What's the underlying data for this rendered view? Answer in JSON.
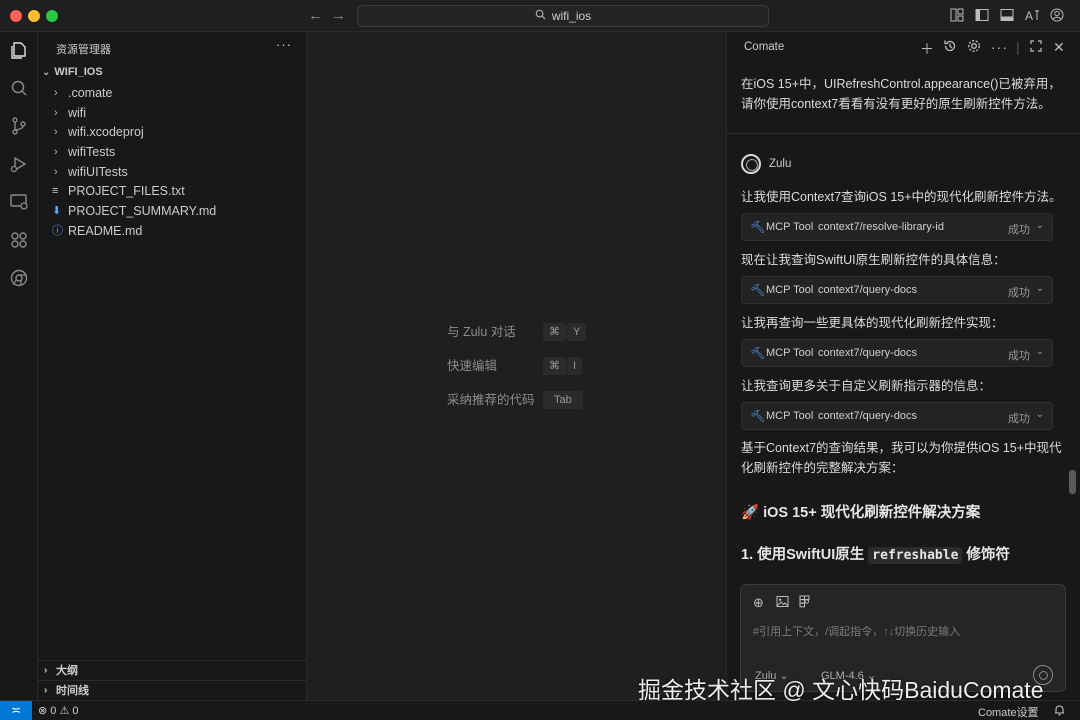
{
  "titlebar": {
    "search_text": "wifi_ios"
  },
  "sidebar": {
    "title": "资源管理器",
    "more": "···",
    "folder": "WIFI_IOS",
    "items": [
      {
        "label": ".comate",
        "kind": "folder"
      },
      {
        "label": "wifi",
        "kind": "folder"
      },
      {
        "label": "wifi.xcodeproj",
        "kind": "folder"
      },
      {
        "label": "wifiTests",
        "kind": "folder"
      },
      {
        "label": "wifiUITests",
        "kind": "folder"
      },
      {
        "label": "PROJECT_FILES.txt",
        "kind": "file-text"
      },
      {
        "label": "PROJECT_SUMMARY.md",
        "kind": "file-download"
      },
      {
        "label": "README.md",
        "kind": "file-info"
      }
    ],
    "outline": "大纲",
    "timeline": "时间线"
  },
  "editor": {
    "hints": [
      {
        "label": "与 Zulu 对话",
        "keys": [
          "⌘",
          "Y"
        ]
      },
      {
        "label": "快速编辑",
        "keys": [
          "⌘",
          "I"
        ]
      },
      {
        "label": "采纳推荐的代码",
        "keys": [
          "Tab"
        ]
      }
    ]
  },
  "panel": {
    "title": "Comate",
    "user_message": "在iOS 15+中，UIRefreshControl.appearance()已被弃用，请你使用context7看看有没有更好的原生刷新控件方法。",
    "bot_name": "Zulu",
    "lines": [
      "让我使用Context7查询iOS 15+中的现代化刷新控件方法。",
      "现在让我查询SwiftUI原生刷新控件的具体信息：",
      "让我再查询一些更具体的现代化刷新控件实现：",
      "让我查询更多关于自定义刷新指示器的信息：",
      "基于Context7的查询结果，我可以为你提供iOS 15+中现代化刷新控件的完整解决方案："
    ],
    "tools": [
      {
        "kind": "MCP Tool",
        "name": "context7/resolve-library-id",
        "status": "成功"
      },
      {
        "kind": "MCP Tool",
        "name": "context7/query-docs",
        "status": "成功"
      },
      {
        "kind": "MCP Tool",
        "name": "context7/query-docs",
        "status": "成功"
      },
      {
        "kind": "MCP Tool",
        "name": "context7/query-docs",
        "status": "成功"
      }
    ],
    "heading1": "🚀 iOS 15+ 现代化刷新控件解决方案",
    "heading2_prefix": "1. 使用SwiftUI原生",
    "heading2_code": "refreshable",
    "heading2_suffix": "修饰符",
    "input_placeholder": "#引用上下文，/调起指令，↑↓切换历史输入",
    "agent_pill": "Zulu ⌄",
    "model_pill": "GLM-4.6 ⌄"
  },
  "statusbar": {
    "errors": "0",
    "warnings": "0",
    "comate_settings": "Comate设置"
  },
  "watermark": "掘金技术社区 @ 文心快码BaiduComate",
  "colors": {
    "accent": "#0078d4",
    "tool_icon": "#5aa3ff"
  }
}
